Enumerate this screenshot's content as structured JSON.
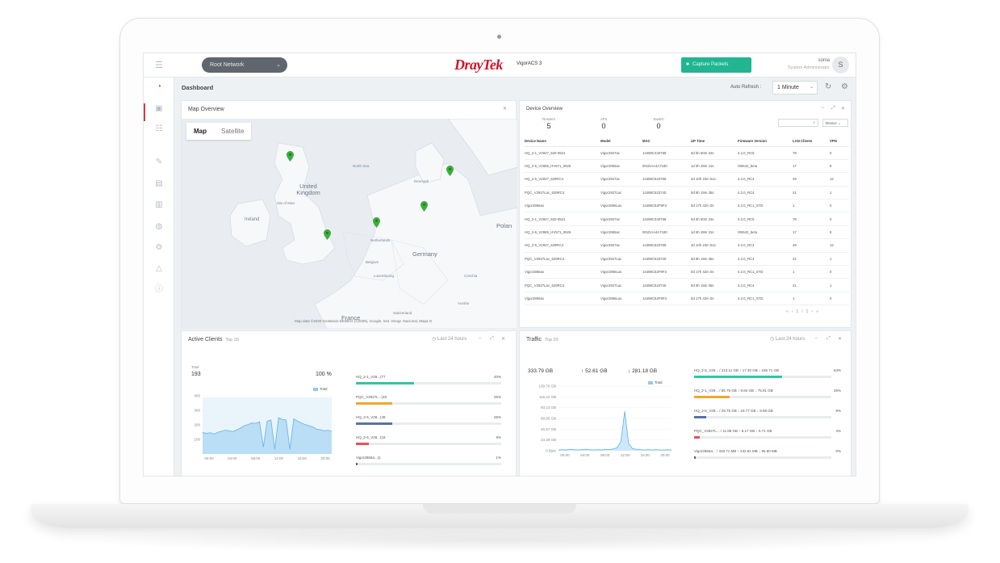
{
  "topbar": {
    "network": "Root Network",
    "brand": "DrayTek",
    "product": "VigorACS 3",
    "capture_button": "Capture Packets",
    "user_name": "sonia",
    "user_role": "System Administrator",
    "avatar_letter": "S"
  },
  "subbar": {
    "title": "Dashboard",
    "auto_refresh_label": "Auto Refresh :",
    "auto_refresh_value": "1 Minute"
  },
  "map_panel": {
    "title": "Map Overview",
    "tab_map": "Map",
    "tab_satellite": "Satellite",
    "labels": {
      "uk": "United Kingdom",
      "ireland": "Ireland",
      "isle": "Isle of Man",
      "northsea": "North Sea",
      "denmark": "Denmark",
      "netherlands": "Netherlands",
      "germany": "Germany",
      "poland": "Polan",
      "belgium": "Belgium",
      "luxembourg": "Luxembourg",
      "czechia": "Czechia",
      "austria": "Austria",
      "france": "France",
      "switzerland": "Switzerland"
    },
    "credit": "Map data ©2020 GeoBasis-DE/BKG (©2009), Google, Inst. Geogr. Nacional, Mapa G"
  },
  "device_panel": {
    "title": "Device Overview",
    "stats": [
      {
        "label": "Routers",
        "value": "5"
      },
      {
        "label": "APs",
        "value": "0"
      },
      {
        "label": "Switch",
        "value": "0"
      }
    ],
    "filter": "Device",
    "columns": [
      "Device Name",
      "Model",
      "MAC",
      "UP Time",
      "Firmware Version",
      "LAN Clients",
      "VPN"
    ],
    "rows": [
      [
        "HQ_2-1_V2927_620-0521",
        "Vigor2927ac",
        "14498C340768",
        "0d 5h 50m 34s",
        "4.2.0_RC5",
        "78",
        "0"
      ],
      [
        "HQ_2-6_V2865_HV571_0526",
        "Vigor2865ac",
        "001DAA4A7180",
        "1d 5h 48m 41s",
        "r90642_beta",
        "17",
        "8"
      ],
      [
        "HQ_2-5_V2927_629RC4",
        "Vigor2927ac",
        "14498C523768",
        "4d 10h 23m 51s",
        "4.2.0_RC4",
        "49",
        "12"
      ],
      [
        "PQC_V2927Lac_629RC4",
        "Vigor2927Lac",
        "14498C523740",
        "0d 8h 19m 35s",
        "4.2.0_RC4",
        "41",
        "1"
      ],
      [
        "Vigor2866ax",
        "Vigor2866Lax",
        "14498C52F9F3",
        "0d 17h 42m 0s",
        "4.2.0_RC1_STD",
        "1",
        "0"
      ],
      [
        "HQ_2-1_V2927_620-0521",
        "Vigor2927ac",
        "14498C340768",
        "0d 5h 50m 34s",
        "4.2.0_RC5",
        "78",
        "0"
      ],
      [
        "HQ_2-6_V2865_HV571_0526",
        "Vigor2865ac",
        "001DAA4A7180",
        "1d 5h 48m 41s",
        "r90642_beta",
        "17",
        "8"
      ],
      [
        "HQ_2-5_V2927_629RC4",
        "Vigor2927ac",
        "14498C523768",
        "4d 10h 23m 51s",
        "4.2.0_RC4",
        "49",
        "12"
      ],
      [
        "PQC_V2927Lac_629RC4",
        "Vigor2927Lac",
        "14498C523740",
        "0d 8h 19m 35s",
        "4.2.0_RC4",
        "41",
        "1"
      ],
      [
        "Vigor2866ax",
        "Vigor2866Lax",
        "14498C52F9F3",
        "0d 17h 42m 0s",
        "4.2.0_RC1_STD",
        "1",
        "0"
      ],
      [
        "PQC_V2927Lac_629RC4",
        "Vigor2927Lac",
        "14498C523740",
        "0d 8h 19m 35s",
        "4.2.0_RC4",
        "41",
        "1"
      ],
      [
        "Vigor2866ax",
        "Vigor2866Lax",
        "14498C52F9F3",
        "0d 17h 42m 0s",
        "4.2.0_RC1_STD",
        "1",
        "0"
      ]
    ],
    "pager": "1/1"
  },
  "clients_panel": {
    "title": "Active Clients",
    "subtitle": "Top 20",
    "range": "Last 24 hours",
    "total_label": "Total",
    "total_value": "193",
    "percent": "100 %",
    "legend": "Total",
    "chart_data": {
      "type": "area",
      "x_ticks": [
        "00:00",
        "04:00",
        "08:00",
        "12:00",
        "16:00",
        "20:00"
      ],
      "y_ticks": [
        "400",
        "300",
        "200",
        "100"
      ],
      "ylim": [
        0,
        500
      ],
      "series": [
        {
          "name": "Total",
          "values": [
            190,
            182,
            188,
            176,
            192,
            200,
            210,
            205,
            198,
            212,
            230,
            250,
            260,
            275,
            270,
            285,
            60,
            290,
            300,
            40,
            320,
            305,
            300,
            40,
            310,
            290,
            275,
            260,
            250,
            240,
            220,
            215,
            205,
            210,
            200
          ]
        }
      ]
    },
    "bars": [
      {
        "name": "HQ_2-1_V29...(77",
        "pct": "40%",
        "value": 0.4,
        "color": "#2fc7a0"
      },
      {
        "name": "PQC_V2927L...(48",
        "pct": "25%",
        "value": 0.25,
        "color": "#f4a72b"
      },
      {
        "name": "HQ_2-5_V29...(49",
        "pct": "25%",
        "value": 0.25,
        "color": "#5673a6"
      },
      {
        "name": "HQ_2-6_V28...(18",
        "pct": "9%",
        "value": 0.09,
        "color": "#e8505b"
      },
      {
        "name": "Vigor2866a...(1",
        "pct": "1%",
        "value": 0.01,
        "color": "#6b52a8"
      }
    ]
  },
  "traffic_panel": {
    "title": "Traffic",
    "subtitle": "Top 20",
    "range": "Last 24 hours",
    "totals": [
      "333.79 GB",
      "52.61 GB",
      "281.18 GB"
    ],
    "legend": "Total",
    "chart_data": {
      "type": "area",
      "x_ticks": [
        "00:00",
        "04:00",
        "08:00",
        "12:00",
        "16:00",
        "20:00"
      ],
      "y_ticks": [
        "139.70 GB",
        "116.42 GB",
        "93.13 GB",
        "69.85 GB",
        "46.57 GB",
        "23.28 GB",
        "0 Byte"
      ],
      "ylim": [
        0,
        139.7
      ],
      "series": [
        {
          "name": "Total",
          "values": [
            2,
            3,
            2,
            4,
            3,
            2,
            3,
            4,
            3,
            2,
            3,
            2,
            4,
            3,
            5,
            8,
            25,
            110,
            20,
            6,
            4,
            3,
            2,
            3,
            2,
            3,
            2,
            2,
            3,
            2
          ]
        }
      ]
    },
    "bars": [
      {
        "name": "HQ_2-5_V29... / 213.11 GB  ↑ 17.40 GB  ↓ 195.71 GB",
        "pct": "64%",
        "value": 0.64,
        "color": "#2fc7a0"
      },
      {
        "name": "HQ_2-1_V29... / 85.75 GB  ↑ 9.84 GB  ↓ 75.91 GB",
        "pct": "26%",
        "value": 0.26,
        "color": "#f4a72b"
      },
      {
        "name": "HQ_2-6_V28... / 29.75 GB  ↑ 19.77 GB  ↓ 9.98 GB",
        "pct": "9%",
        "value": 0.09,
        "color": "#5673a6"
      },
      {
        "name": "PQC_V2927L... / 11.88 GB  ↑ 5.17 GB  ↓ 6.71 GB",
        "pct": "4%",
        "value": 0.04,
        "color": "#e8505b"
      },
      {
        "name": "Vigor2866a... / 328.71 MB  ↑ 232.81 MB  ↓ 95.90 MB",
        "pct": "0%",
        "value": 0.005,
        "color": "#6b52a8"
      }
    ]
  }
}
